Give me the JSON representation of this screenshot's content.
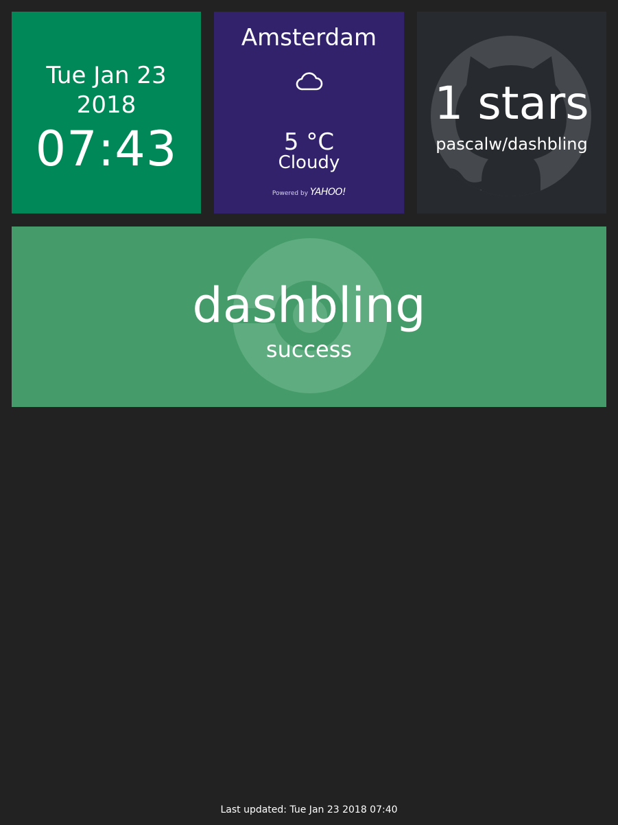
{
  "clock": {
    "date": "Tue Jan 23 2018",
    "time": "07:43"
  },
  "weather": {
    "city": "Amsterdam",
    "icon": "cloud-icon",
    "temperature": "5 °C",
    "condition": "Cloudy",
    "powered_by": "Powered by",
    "provider": "YAHOO!"
  },
  "github": {
    "icon": "github-octocat-icon",
    "stars": "1 stars",
    "repo": "pascalw/dashbling"
  },
  "build": {
    "icon": "circleci-icon",
    "name": "dashbling",
    "status": "success"
  },
  "footer": {
    "last_updated": "Last updated: Tue Jan 23 2018 07:40"
  },
  "colors": {
    "background": "#222222",
    "clock_tile": "#008858",
    "weather_tile": "#31226b",
    "github_tile": "#272a2e",
    "build_tile_success": "#459b69"
  }
}
